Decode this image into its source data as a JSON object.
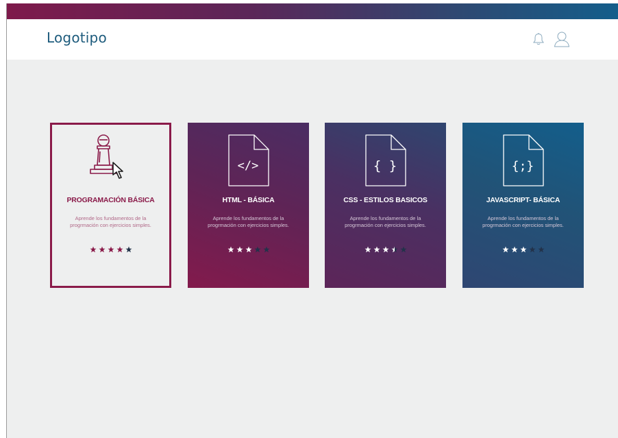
{
  "header": {
    "logo": "Logotipo",
    "icons": [
      "bell-icon",
      "user-icon"
    ]
  },
  "colors": {
    "brand_magenta": "#8a1a49",
    "brand_blue": "#135e8b",
    "logo_text": "#1d5b7c",
    "background": "#eeefef"
  },
  "courses": [
    {
      "title": "PROGRAMACIÓN BÁSICA",
      "description": "Aprende los fundamentos de la progrmación con ejercicios simples.",
      "icon": "chess-pawn-icon",
      "rating": 4,
      "rating_max": 5,
      "selected": true
    },
    {
      "title": "HTML - BÁSICA",
      "description": "Aprende los fundamentos de la progrmación con ejercicios simples.",
      "icon": "html-file-icon",
      "icon_text": "</>",
      "rating": 3,
      "rating_max": 5,
      "selected": false
    },
    {
      "title": "CSS - ESTILOS BASICOS",
      "description": "Aprende los fundamentos de la progrmación con ejercicios simples.",
      "icon": "css-file-icon",
      "icon_text": "{ }",
      "rating": 3.5,
      "rating_max": 5,
      "selected": false
    },
    {
      "title": "JAVASCRIPT- BÁSICA",
      "description": "Aprende los fundamentos de la progrmación con ejercicios simples.",
      "icon": "javascript-file-icon",
      "icon_text": "{;}",
      "rating": 3,
      "rating_max": 5,
      "selected": false
    }
  ]
}
